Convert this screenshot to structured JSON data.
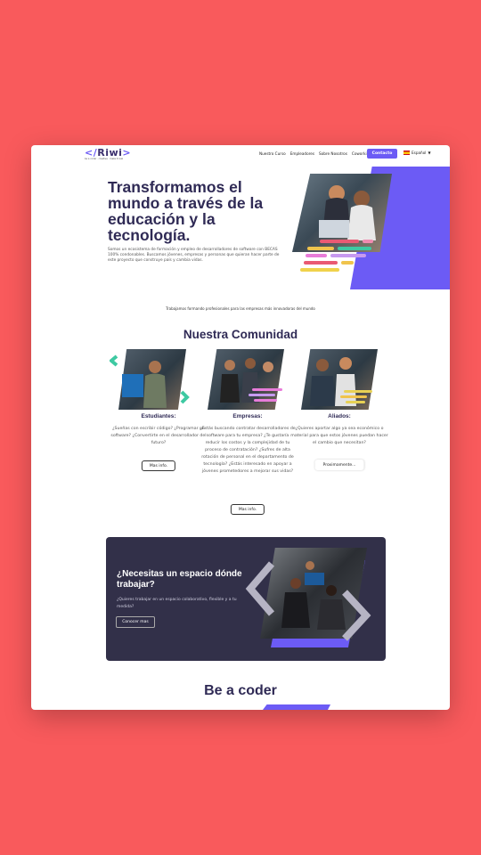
{
  "nav": {
    "logo": "Riwi",
    "logo_subtitle": "be a coder · creative · make it real",
    "items": [
      "Nuestro Curso",
      "Empleadores",
      "Sobre Nosotros",
      "Coworking"
    ],
    "contact_label": "Contacto",
    "language": "Español"
  },
  "hero": {
    "title": "Transformamos el mundo a través de la educación y la tecnología.",
    "description": "Somos un ecosistema de formación y empleo de desarrolladores de software con BECAS 100% condonables. Buscamos jóvenes, empresas y personas que quieran hacer parte de este proyecto que construye país y cambia vidas."
  },
  "tagline": "Trabajamos formando profesionales para las empresas más innovadoras del mundo",
  "community": {
    "title": "Nuestra Comunidad",
    "columns": [
      {
        "title": "Estudiantes:",
        "text": "¿Sueñas con escribir código? ¿Programar un software? ¿Convertirte en el desarrollador del futuro?",
        "button": "Mas info."
      },
      {
        "title": "Empresas:",
        "text": "¿Estás buscando contratar desarrolladores de software para tu empresa? ¿Te gustaría reducir los costos y la complejidad de tu proceso de contratación? ¿Sufres de alta rotación de personal en el departamento de tecnología? ¿Estás interesado en apoyar a jóvenes prometedores a mejorar sus vidas?",
        "button": "Mas info."
      },
      {
        "title": "Aliados:",
        "text": "¿Quieres aportar algo ya sea económico o material para que estos jóvenes puedan hacer el cambio que necesitan?",
        "button": "Proximamente..."
      }
    ]
  },
  "coworking": {
    "title": "¿Necesitas un espacio dónde trabajar?",
    "text": "¿Quieres trabajar en un espacio colaborativo, flexible y a tu medida?",
    "button": "Conocer mas"
  },
  "bottom_title": "Be a coder",
  "colors": {
    "background": "#f95a5c",
    "brand_purple": "#6c5bf5",
    "navy_text": "#2f2a55",
    "dark_card": "#323049",
    "teal_accent": "#3ec9a2",
    "pink_accent": "#e87cd9",
    "yellow_accent": "#e8d155"
  }
}
